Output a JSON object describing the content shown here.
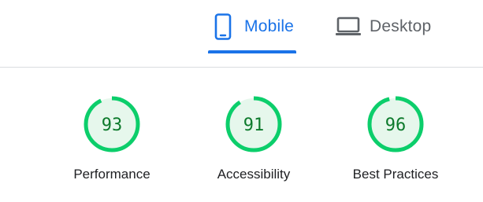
{
  "tabs": {
    "mobile": {
      "label": "Mobile",
      "icon": "smartphone-icon",
      "active": true
    },
    "desktop": {
      "label": "Desktop",
      "icon": "laptop-icon",
      "active": false
    }
  },
  "colors": {
    "accent": "#1a73e8",
    "inactive": "#5f6368",
    "score_pass": "#0cce6b",
    "score_pass_fill": "#e6f7ec",
    "score_pass_text": "#0d7a2c"
  },
  "categories": [
    {
      "label": "Performance",
      "score": "93",
      "value": 93
    },
    {
      "label": "Accessibility",
      "score": "91",
      "value": 91
    },
    {
      "label": "Best Practices",
      "score": "96",
      "value": 96
    }
  ]
}
